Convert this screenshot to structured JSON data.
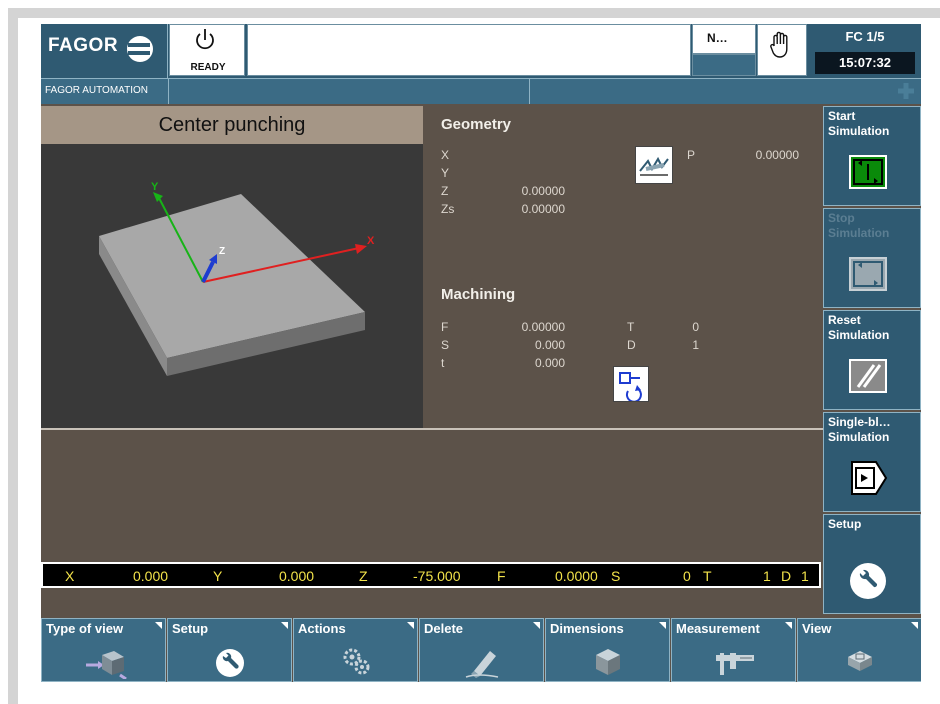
{
  "header": {
    "brand": "FAGOR",
    "brand_sub": "FAGOR AUTOMATION",
    "status": "READY",
    "message": "",
    "n_field": "N…",
    "channel": "FC 1/5",
    "time": "15:07:32"
  },
  "view": {
    "title": "Center punching",
    "axes": {
      "x": "X",
      "y": "Y",
      "z": "Z"
    }
  },
  "geometry": {
    "title": "Geometry",
    "fields": [
      {
        "label": "X",
        "value": ""
      },
      {
        "label": "Y",
        "value": ""
      },
      {
        "label": "Z",
        "value": "0.00000"
      },
      {
        "label": "Zs",
        "value": "0.00000"
      }
    ],
    "p_label": "P",
    "p_value": "0.00000"
  },
  "machining": {
    "title": "Machining",
    "fields": [
      {
        "label": "F",
        "value": "0.00000"
      },
      {
        "label": "S",
        "value": "0.000"
      },
      {
        "label": "t",
        "value": "0.000"
      }
    ],
    "t_label": "T",
    "t_value": "0",
    "d_label": "D",
    "d_value": "1"
  },
  "status_line": {
    "x_label": "X",
    "x_value": "0.000",
    "y_label": "Y",
    "y_value": "0.000",
    "z_label": "Z",
    "z_value": "-75.000",
    "f_label": "F",
    "f_value": "0.0000",
    "s_label": "S",
    "s_value": "0",
    "t_label": "T",
    "t_value": "1",
    "d_label": "D",
    "d_value": "1"
  },
  "vertical_softkeys": [
    {
      "label": "Start\nSimulation",
      "icon": "start-simulation-icon",
      "enabled": true
    },
    {
      "label": "Stop\nSimulation",
      "icon": "stop-simulation-icon",
      "enabled": false
    },
    {
      "label": "Reset\nSimulation",
      "icon": "reset-simulation-icon",
      "enabled": true
    },
    {
      "label": "Single-bl…\nSimulation",
      "icon": "single-block-icon",
      "enabled": true
    },
    {
      "label": "Setup",
      "icon": "wrench-icon",
      "enabled": true
    }
  ],
  "horizontal_softkeys": [
    {
      "label": "Type of view",
      "icon": "view-type-icon"
    },
    {
      "label": "Setup",
      "icon": "wrench-icon"
    },
    {
      "label": "Actions",
      "icon": "gears-icon"
    },
    {
      "label": "Delete",
      "icon": "eraser-icon"
    },
    {
      "label": "Dimensions",
      "icon": "cube-icon"
    },
    {
      "label": "Measurement",
      "icon": "caliper-icon"
    },
    {
      "label": "View",
      "icon": "view-icon"
    }
  ],
  "colors": {
    "panel_bg": "#5c5249",
    "softkey_bg": "#2f5a72",
    "status_text": "#f3e34a",
    "axis_x": "#e02020",
    "axis_y": "#17b317",
    "axis_z": "#1e3cd0"
  }
}
